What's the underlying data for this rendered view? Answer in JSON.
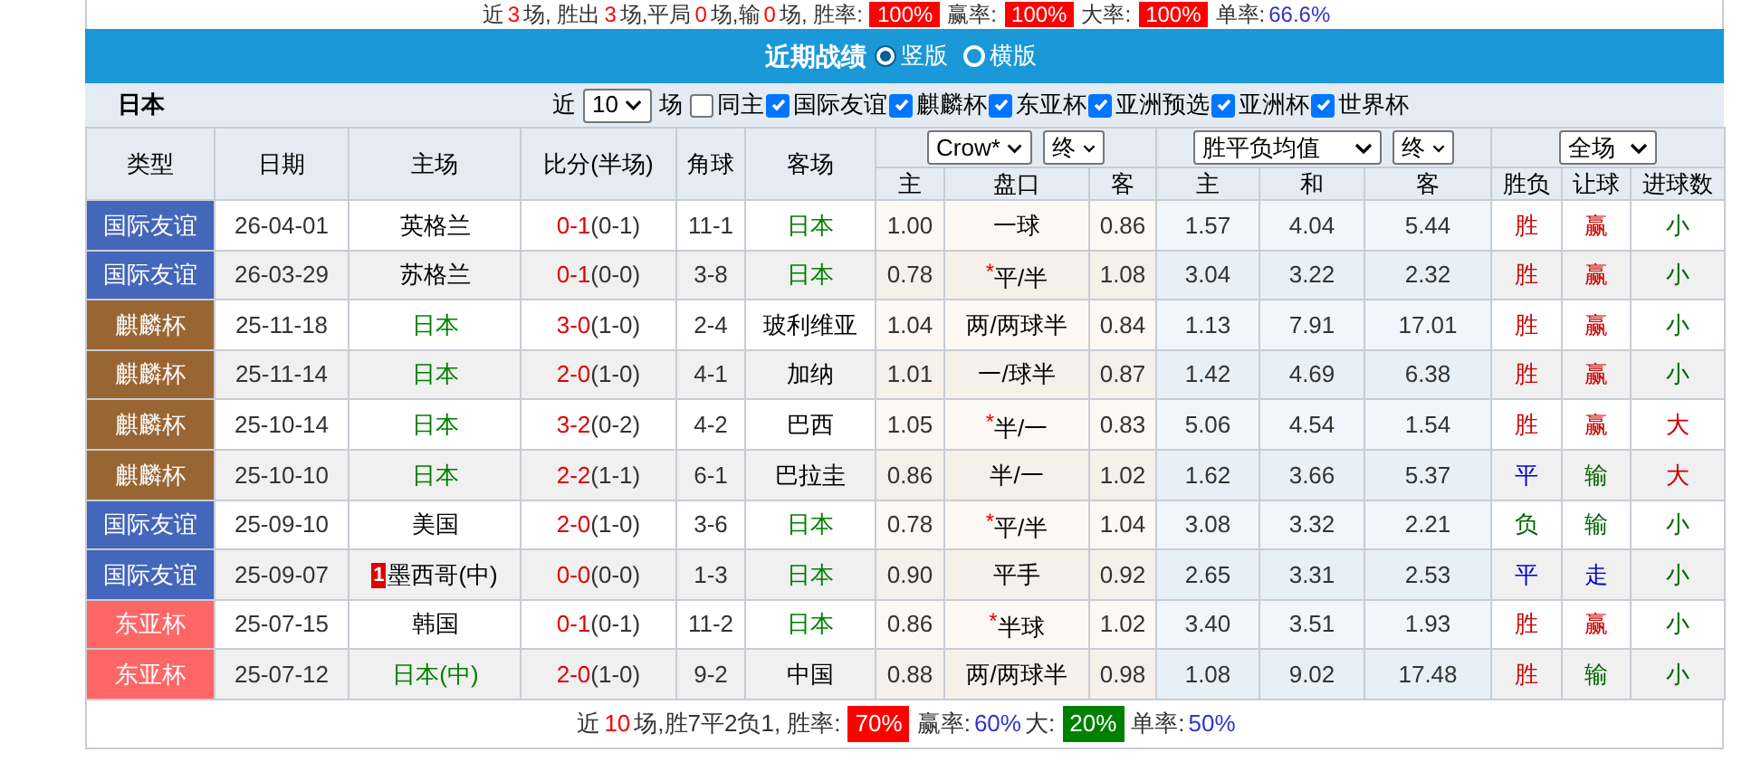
{
  "top_summary": [
    {
      "kind": "text",
      "text": "近"
    },
    {
      "kind": "num",
      "text": "3"
    },
    {
      "kind": "text",
      "text": "场, 胜出"
    },
    {
      "kind": "num",
      "text": "3"
    },
    {
      "kind": "text",
      "text": "场,平局"
    },
    {
      "kind": "num",
      "text": "0"
    },
    {
      "kind": "text",
      "text": "场,输"
    },
    {
      "kind": "num",
      "text": "0"
    },
    {
      "kind": "text",
      "text": "场, 胜率:"
    },
    {
      "kind": "badge",
      "text": "100%",
      "color": "#ff0000"
    },
    {
      "kind": "text",
      "text": "赢率:"
    },
    {
      "kind": "badge",
      "text": "100%",
      "color": "#ff0000"
    },
    {
      "kind": "text",
      "text": "大率:"
    },
    {
      "kind": "badge",
      "text": "100%",
      "color": "#ff0000"
    },
    {
      "kind": "text",
      "text": "单率:"
    },
    {
      "kind": "rate",
      "text": "66.6%"
    }
  ],
  "section": {
    "title": "近期战绩",
    "layouts": [
      {
        "label": "竖版",
        "selected": true
      },
      {
        "label": "横版",
        "selected": false
      }
    ]
  },
  "filter": {
    "team": "日本",
    "prefix": "近",
    "count": "10",
    "suffix": "场",
    "options": [
      {
        "label": "同主",
        "checked": false
      },
      {
        "label": "国际友谊",
        "checked": true
      },
      {
        "label": "麒麟杯",
        "checked": true
      },
      {
        "label": "东亚杯",
        "checked": true
      },
      {
        "label": "亚洲预选",
        "checked": true
      },
      {
        "label": "亚洲杯",
        "checked": true
      },
      {
        "label": "世界杯",
        "checked": true
      }
    ]
  },
  "columns": {
    "type": "类型",
    "date": "日期",
    "home": "主场",
    "score": "比分(半场)",
    "corners": "角球",
    "away": "客场",
    "handicap_company": "Crow*",
    "handicap_phase": "终",
    "odds_type": "胜平负均值",
    "odds_phase": "终",
    "scope": "全场",
    "handicap_sub": [
      "主",
      "盘口",
      "客"
    ],
    "odds_sub": [
      "主",
      "和",
      "客"
    ],
    "result_sub": [
      "胜负",
      "让球",
      "进球数"
    ]
  },
  "rows": [
    {
      "type": "国际友谊",
      "color": "#4466bb",
      "date": "26-04-01",
      "home": "英格兰",
      "home_japan": false,
      "score": "0-1",
      "half": "(0-1)",
      "corners": "11-1",
      "away": "日本",
      "away_japan": true,
      "h_home": "1.00",
      "line": "一球",
      "h_away": "0.86",
      "o_home": "1.57",
      "o_draw": "4.04",
      "o_away": "5.44",
      "result": {
        "text": "胜",
        "color": "#cc0000"
      },
      "hcp": {
        "text": "赢",
        "color": "#cc0000"
      },
      "goals": {
        "text": "小",
        "color": "#006600"
      }
    },
    {
      "type": "国际友谊",
      "color": "#4466bb",
      "date": "26-03-29",
      "home": "苏格兰",
      "home_japan": false,
      "score": "0-1",
      "half": "(0-0)",
      "corners": "3-8",
      "away": "日本",
      "away_japan": true,
      "h_home": "0.78",
      "line_mark": "*",
      "line": "平/半",
      "h_away": "1.08",
      "o_home": "3.04",
      "o_draw": "3.22",
      "o_away": "2.32",
      "result": {
        "text": "胜",
        "color": "#cc0000"
      },
      "hcp": {
        "text": "赢",
        "color": "#cc0000"
      },
      "goals": {
        "text": "小",
        "color": "#006600"
      }
    },
    {
      "type": "麒麟杯",
      "color": "#996633",
      "date": "25-11-18",
      "home": "日本",
      "home_japan": true,
      "score": "3-0",
      "half": "(1-0)",
      "corners": "2-4",
      "away": "玻利维亚",
      "away_japan": false,
      "h_home": "1.04",
      "line": "两/两球半",
      "h_away": "0.84",
      "o_home": "1.13",
      "o_draw": "7.91",
      "o_away": "17.01",
      "result": {
        "text": "胜",
        "color": "#cc0000"
      },
      "hcp": {
        "text": "赢",
        "color": "#cc0000"
      },
      "goals": {
        "text": "小",
        "color": "#006600"
      }
    },
    {
      "type": "麒麟杯",
      "color": "#996633",
      "date": "25-11-14",
      "home": "日本",
      "home_japan": true,
      "score": "2-0",
      "half": "(1-0)",
      "corners": "4-1",
      "away": "加纳",
      "away_japan": false,
      "h_home": "1.01",
      "line": "一/球半",
      "h_away": "0.87",
      "o_home": "1.42",
      "o_draw": "4.69",
      "o_away": "6.38",
      "result": {
        "text": "胜",
        "color": "#cc0000"
      },
      "hcp": {
        "text": "赢",
        "color": "#cc0000"
      },
      "goals": {
        "text": "小",
        "color": "#006600"
      }
    },
    {
      "type": "麒麟杯",
      "color": "#996633",
      "date": "25-10-14",
      "home": "日本",
      "home_japan": true,
      "score": "3-2",
      "half": "(0-2)",
      "corners": "4-2",
      "away": "巴西",
      "away_japan": false,
      "h_home": "1.05",
      "line_mark": "*",
      "line": "半/一",
      "h_away": "0.83",
      "o_home": "5.06",
      "o_draw": "4.54",
      "o_away": "1.54",
      "result": {
        "text": "胜",
        "color": "#cc0000"
      },
      "hcp": {
        "text": "赢",
        "color": "#cc0000"
      },
      "goals": {
        "text": "大",
        "color": "#cc0000"
      }
    },
    {
      "type": "麒麟杯",
      "color": "#996633",
      "date": "25-10-10",
      "home": "日本",
      "home_japan": true,
      "score": "2-2",
      "half": "(1-1)",
      "corners": "6-1",
      "away": "巴拉圭",
      "away_japan": false,
      "h_home": "0.86",
      "line": "半/一",
      "h_away": "1.02",
      "o_home": "1.62",
      "o_draw": "3.66",
      "o_away": "5.37",
      "result": {
        "text": "平",
        "color": "#0000cc"
      },
      "hcp": {
        "text": "输",
        "color": "#006600"
      },
      "goals": {
        "text": "大",
        "color": "#cc0000"
      }
    },
    {
      "type": "国际友谊",
      "color": "#4466bb",
      "date": "25-09-10",
      "home": "美国",
      "home_japan": false,
      "score": "2-0",
      "half": "(1-0)",
      "corners": "3-6",
      "away": "日本",
      "away_japan": true,
      "h_home": "0.78",
      "line_mark": "*",
      "line": "平/半",
      "h_away": "1.04",
      "o_home": "3.08",
      "o_draw": "3.32",
      "o_away": "2.21",
      "result": {
        "text": "负",
        "color": "#006600"
      },
      "hcp": {
        "text": "输",
        "color": "#006600"
      },
      "goals": {
        "text": "小",
        "color": "#006600"
      }
    },
    {
      "type": "国际友谊",
      "color": "#4466bb",
      "date": "25-09-07",
      "home": "墨西哥(中)",
      "home_japan": false,
      "red_cards": "1",
      "score": "0-0",
      "half": "(0-0)",
      "corners": "1-3",
      "away": "日本",
      "away_japan": true,
      "h_home": "0.90",
      "line": "平手",
      "h_away": "0.92",
      "o_home": "2.65",
      "o_draw": "3.31",
      "o_away": "2.53",
      "result": {
        "text": "平",
        "color": "#0000cc"
      },
      "hcp": {
        "text": "走",
        "color": "#0000cc"
      },
      "goals": {
        "text": "小",
        "color": "#006600"
      }
    },
    {
      "type": "东亚杯",
      "color": "#ff6666",
      "date": "25-07-15",
      "home": "韩国",
      "home_japan": false,
      "score": "0-1",
      "half": "(0-1)",
      "corners": "11-2",
      "away": "日本",
      "away_japan": true,
      "h_home": "0.86",
      "line_mark": "*",
      "line": "半球",
      "h_away": "1.02",
      "o_home": "3.40",
      "o_draw": "3.51",
      "o_away": "1.93",
      "result": {
        "text": "胜",
        "color": "#cc0000"
      },
      "hcp": {
        "text": "赢",
        "color": "#cc0000"
      },
      "goals": {
        "text": "小",
        "color": "#006600"
      }
    },
    {
      "type": "东亚杯",
      "color": "#ff6666",
      "date": "25-07-12",
      "home": "日本(中)",
      "home_japan": true,
      "score": "2-0",
      "half": "(1-0)",
      "corners": "9-2",
      "away": "中国",
      "away_japan": false,
      "h_home": "0.88",
      "line": "两/两球半",
      "h_away": "0.98",
      "o_home": "1.08",
      "o_draw": "9.02",
      "o_away": "17.48",
      "result": {
        "text": "胜",
        "color": "#cc0000"
      },
      "hcp": {
        "text": "输",
        "color": "#006600"
      },
      "goals": {
        "text": "小",
        "color": "#006600"
      }
    }
  ],
  "footer": [
    {
      "kind": "text",
      "text": "近"
    },
    {
      "kind": "num",
      "text": "10"
    },
    {
      "kind": "text",
      "text": "场,胜7平2负1, 胜率:"
    },
    {
      "kind": "badge",
      "text": "70%",
      "color": "#ff0000"
    },
    {
      "kind": "text",
      "text": "赢率:"
    },
    {
      "kind": "rate",
      "text": "60%"
    },
    {
      "kind": "text",
      "text": "大:"
    },
    {
      "kind": "badge",
      "text": "20%",
      "color": "#008000"
    },
    {
      "kind": "text",
      "text": "单率:"
    },
    {
      "kind": "rate",
      "text": "50%"
    }
  ]
}
